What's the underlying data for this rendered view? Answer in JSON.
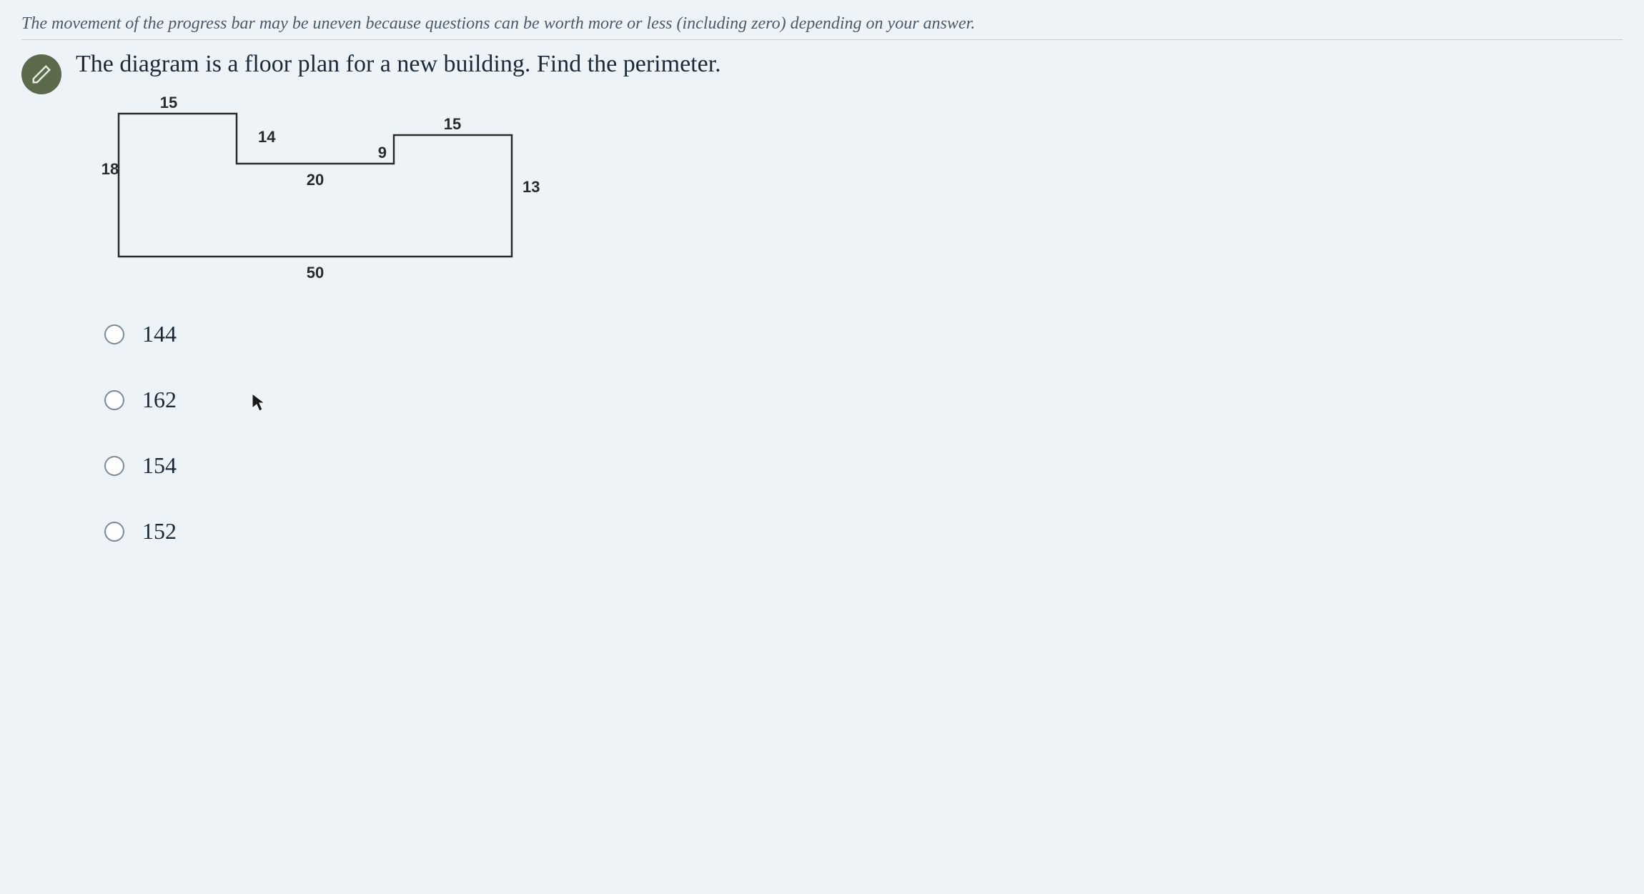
{
  "progress_note": "The movement of the progress bar may be uneven because questions can be worth more or less (including zero) depending on your answer.",
  "question": "The diagram is a floor plan for a new building. Find the perimeter.",
  "diagram": {
    "labels": {
      "top_left": "15",
      "left": "18",
      "step1_right": "14",
      "step1_bottom": "20",
      "step2_left": "9",
      "step2_top": "15",
      "right": "13",
      "bottom": "50"
    }
  },
  "options": [
    {
      "value": "144"
    },
    {
      "value": "162"
    },
    {
      "value": "154"
    },
    {
      "value": "152"
    }
  ]
}
